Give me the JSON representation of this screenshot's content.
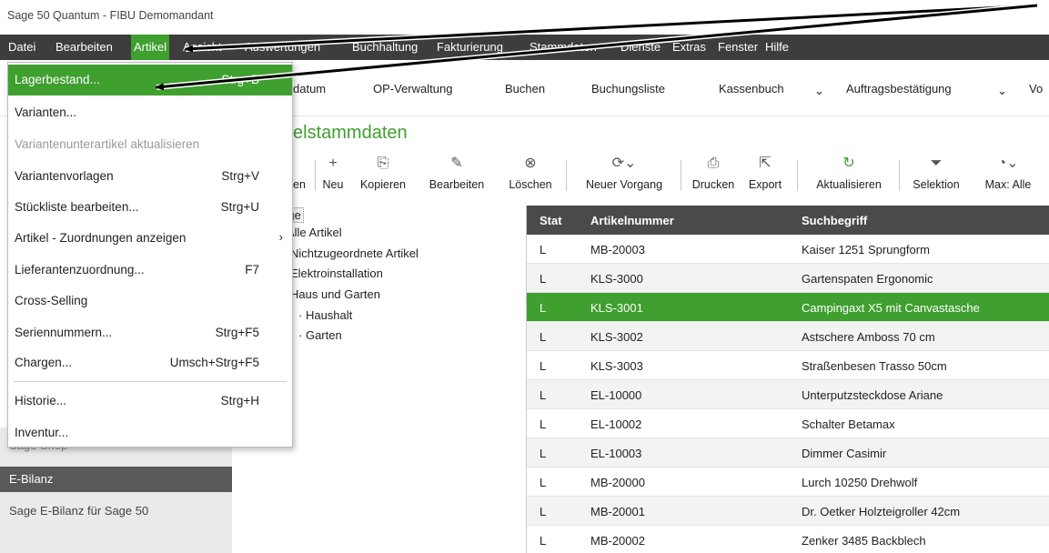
{
  "window": {
    "title": "Sage 50 Quantum - FIBU Demomandant"
  },
  "menubar": {
    "items": [
      "Datei",
      "Bearbeiten",
      "Artikel",
      "Ansicht",
      "Auswertungen",
      "Buchhaltung",
      "Fakturierung",
      "Stammdaten",
      "Dienste",
      "Extras",
      "Fenster",
      "Hilfe"
    ],
    "active": "Artikel"
  },
  "toolbar1": {
    "items": [
      "datum",
      "OP-Verwaltung",
      "Buchen",
      "Buchungsliste",
      "Kassenbuch",
      "Auftragsbestätigung",
      "Vo"
    ]
  },
  "module": {
    "title": "elstammdaten"
  },
  "toolbar2": {
    "buttons": [
      "en",
      "Neu",
      "Kopieren",
      "Bearbeiten",
      "Löschen",
      "Neuer Vorgang",
      "Drucken",
      "Export",
      "Aktualisieren",
      "Selektion",
      "Max: Alle"
    ]
  },
  "sidebar": {
    "cut_item": "Sage Shop",
    "section": "E-Bilanz",
    "item": "Sage E-Bilanz für Sage 50"
  },
  "tree": {
    "root": "aloge",
    "nodes": [
      "Alle Artikel",
      "Nichtzugeordnete Artikel",
      "Elektroinstallation",
      "Haus und Garten",
      "Haushalt",
      "Garten"
    ]
  },
  "grid": {
    "columns": [
      "Stat",
      "Artikelnummer",
      "Suchbegriff"
    ],
    "rows": [
      [
        "L",
        "MB-20003",
        "Kaiser 1251 Sprungform"
      ],
      [
        "L",
        "KLS-3000",
        "Gartenspaten Ergonomic"
      ],
      [
        "L",
        "KLS-3001",
        "Campingaxt X5 mit Canvastasche"
      ],
      [
        "L",
        "KLS-3002",
        "Astschere Amboss 70 cm"
      ],
      [
        "L",
        "KLS-3003",
        "Straßenbesen Trasso 50cm"
      ],
      [
        "L",
        "EL-10000",
        "Unterputzsteckdose Ariane"
      ],
      [
        "L",
        "EL-10002",
        "Schalter Betamax"
      ],
      [
        "L",
        "EL-10003",
        "Dimmer Casimir"
      ],
      [
        "L",
        "MB-20000",
        "Lurch 10250 Drehwolf"
      ],
      [
        "L",
        "MB-20001",
        "Dr. Oetker Holzteigroller 42cm"
      ],
      [
        "L",
        "MB-20002",
        "Zenker 3485 Backblech"
      ]
    ],
    "selected_article": "KLS-3001"
  },
  "dropdown": {
    "items": [
      {
        "label": "Lagerbestand...",
        "shortcut": "Strg+B",
        "state": "highlighted"
      },
      {
        "label": "Varianten...",
        "shortcut": "",
        "state": "normal"
      },
      {
        "label": "Variantenunterartikel aktualisieren",
        "shortcut": "",
        "state": "disabled"
      },
      {
        "label": "Variantenvorlagen",
        "shortcut": "Strg+V",
        "state": "normal"
      },
      {
        "label": "Stückliste bearbeiten...",
        "shortcut": "Strg+U",
        "state": "normal"
      },
      {
        "label": "Artikel - Zuordnungen anzeigen",
        "shortcut": "",
        "state": "submenu"
      },
      {
        "label": "Lieferantenzuordnung...",
        "shortcut": "F7",
        "state": "normal"
      },
      {
        "label": "Cross-Selling",
        "shortcut": "",
        "state": "normal"
      },
      {
        "label": "Seriennummern...",
        "shortcut": "Strg+F5",
        "state": "normal"
      },
      {
        "label": "Chargen...",
        "shortcut": "Umsch+Strg+F5",
        "state": "normal"
      },
      {
        "label": "Historie...",
        "shortcut": "Strg+H",
        "state": "normal"
      },
      {
        "label": "Inventur...",
        "shortcut": "",
        "state": "normal"
      }
    ]
  },
  "colors": {
    "accent": "#3f9f2f",
    "menubar": "#3d3d3d",
    "grid_header": "#4a4a4a"
  }
}
